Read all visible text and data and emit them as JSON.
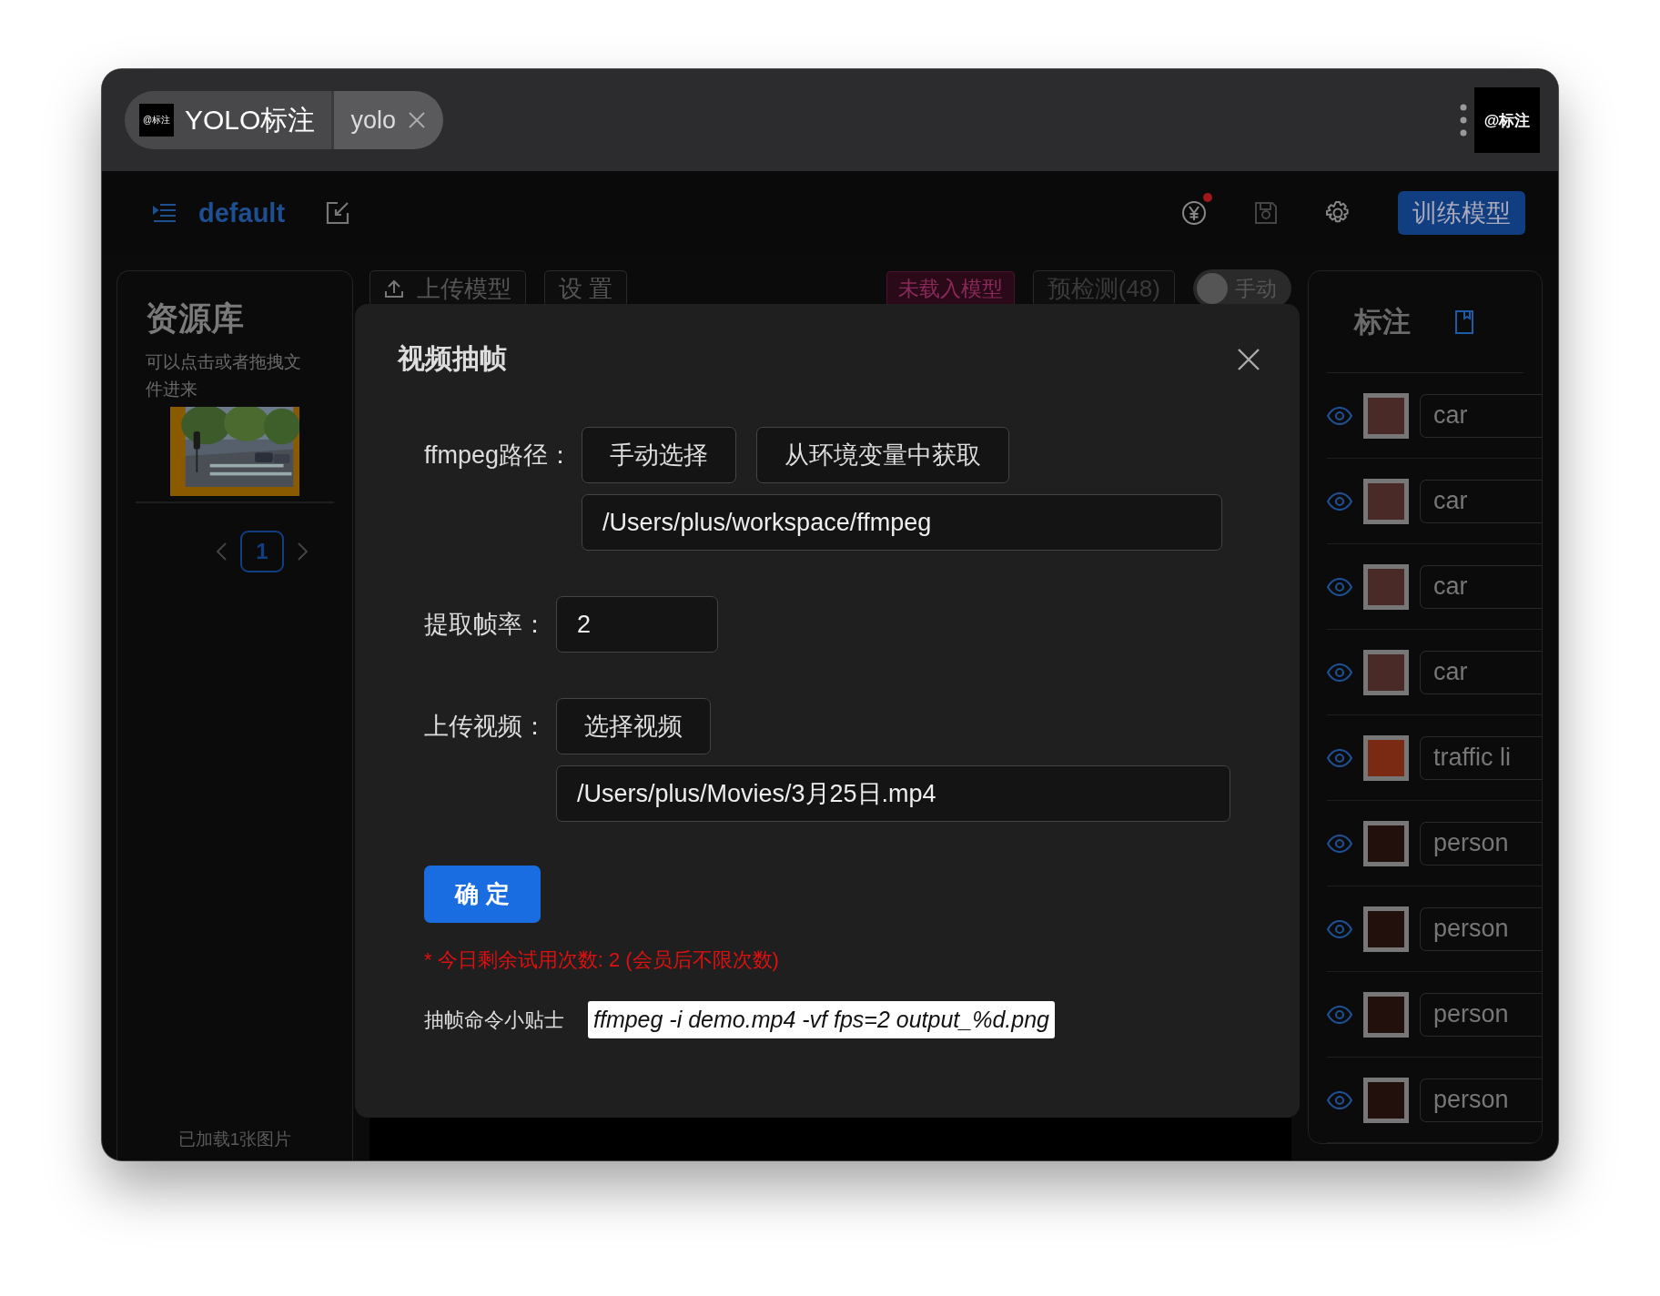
{
  "title_bar": {
    "tab_logo": "@标注",
    "tabs": [
      {
        "label": "YOLO标注",
        "selected": true
      },
      {
        "label": "yolo",
        "selected": false
      }
    ],
    "logo": "@标注"
  },
  "toolbar": {
    "project": "default",
    "notification": true,
    "train_button": "训练模型"
  },
  "library": {
    "title": "资源库",
    "hint": "可以点击或者拖拽文件进来",
    "thumbnails": [
      {
        "kind": "picture",
        "selected": true
      }
    ],
    "pages": [
      {
        "label": "1",
        "selected": true
      }
    ],
    "footer": "已加载1张图片"
  },
  "workspace": {
    "buttons": [
      "上传模型",
      "设 置"
    ],
    "model_status": "未载入模型",
    "precheck": "预检测(48)",
    "mode": {
      "label": "手动",
      "on": false
    }
  },
  "dialog": {
    "title": "视频抽帧",
    "ffmpeg_path": {
      "label": "ffmpeg路径：",
      "buttons": [
        "手动选择",
        "从环境变量中获取"
      ],
      "value": "/Users/plus/workspace/ffmpeg"
    },
    "frame_rate": {
      "label": "提取帧率：",
      "value": "2"
    },
    "video": {
      "label": "上传视频：",
      "button": "选择视频",
      "value": "/Users/plus/Movies/3月25日.mp4"
    },
    "confirm": "确 定",
    "notice": "* 今日剩余试用次数: 2 (会员后不限次数)",
    "tip": {
      "label": "抽帧命令小贴士",
      "command": "ffmpeg -i demo.mp4 -vf fps=2 output_%d.png"
    }
  },
  "annotations": {
    "title": "标注",
    "items": [
      {
        "label": "car",
        "color": "#4a2a26",
        "visible": true
      },
      {
        "label": "car",
        "color": "#4a2a26",
        "visible": true
      },
      {
        "label": "car",
        "color": "#4a2a26",
        "visible": true
      },
      {
        "label": "car",
        "color": "#4a2a26",
        "visible": true
      },
      {
        "label": "traffic li",
        "color": "#7a2a12",
        "visible": true
      },
      {
        "label": "person",
        "color": "#22100c",
        "visible": true
      },
      {
        "label": "person",
        "color": "#22100c",
        "visible": true
      },
      {
        "label": "person",
        "color": "#22100c",
        "visible": true
      },
      {
        "label": "person",
        "color": "#22100c",
        "visible": true
      }
    ]
  }
}
